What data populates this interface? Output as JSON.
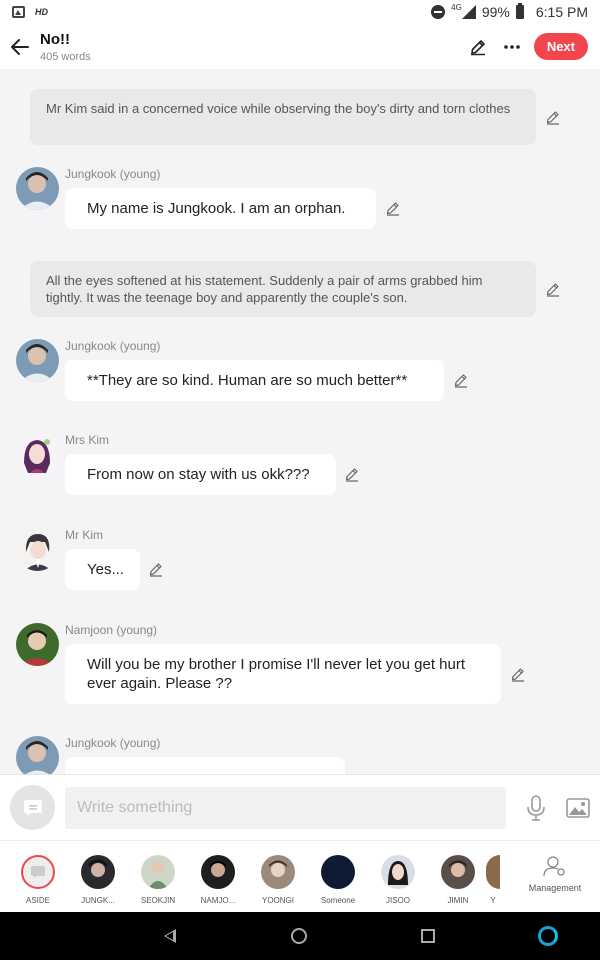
{
  "status_bar": {
    "hd_label": "HD",
    "network": "4G",
    "battery": "99%",
    "time": "6:15 PM"
  },
  "header": {
    "title": "No!!",
    "word_count": "405 words",
    "next_label": "Next"
  },
  "messages": [
    {
      "type": "aside",
      "text": "Mr Kim said in a concerned voice while observing the boy's dirty and torn clothes"
    },
    {
      "type": "dialogue",
      "speaker": "Jungkook (young)",
      "text": "My name is Jungkook. I am an orphan."
    },
    {
      "type": "aside",
      "text": "All the eyes softened at his statement. Suddenly a pair of arms grabbed him tightly. It was the teenage boy and apparently the couple's son."
    },
    {
      "type": "dialogue",
      "speaker": "Jungkook (young)",
      "text": "**They are so kind. Human are so much better**"
    },
    {
      "type": "dialogue",
      "speaker": "Mrs Kim",
      "text": "From now on stay with us okk???"
    },
    {
      "type": "dialogue",
      "speaker": "Mr Kim",
      "text": "Yes..."
    },
    {
      "type": "dialogue",
      "speaker": "Namjoon (young)",
      "text": "Will you be my brother I promise I'll never let you get hurt ever again. Please ??"
    },
    {
      "type": "dialogue",
      "speaker": "Jungkook (young)",
      "text": ""
    }
  ],
  "input": {
    "placeholder": "Write something"
  },
  "characters": [
    {
      "label": "ASIDE"
    },
    {
      "label": "JUNGK..."
    },
    {
      "label": "SEOKJIN"
    },
    {
      "label": "NAMJO..."
    },
    {
      "label": "YOONGI"
    },
    {
      "label": "Someone"
    },
    {
      "label": "JISOO"
    },
    {
      "label": "JIMIN"
    },
    {
      "label": "Y"
    }
  ],
  "management_label": "Management",
  "colors": {
    "accent": "#f2464e",
    "aside_bg": "#e9e9ec",
    "chat_bg": "#f4f4f6"
  }
}
